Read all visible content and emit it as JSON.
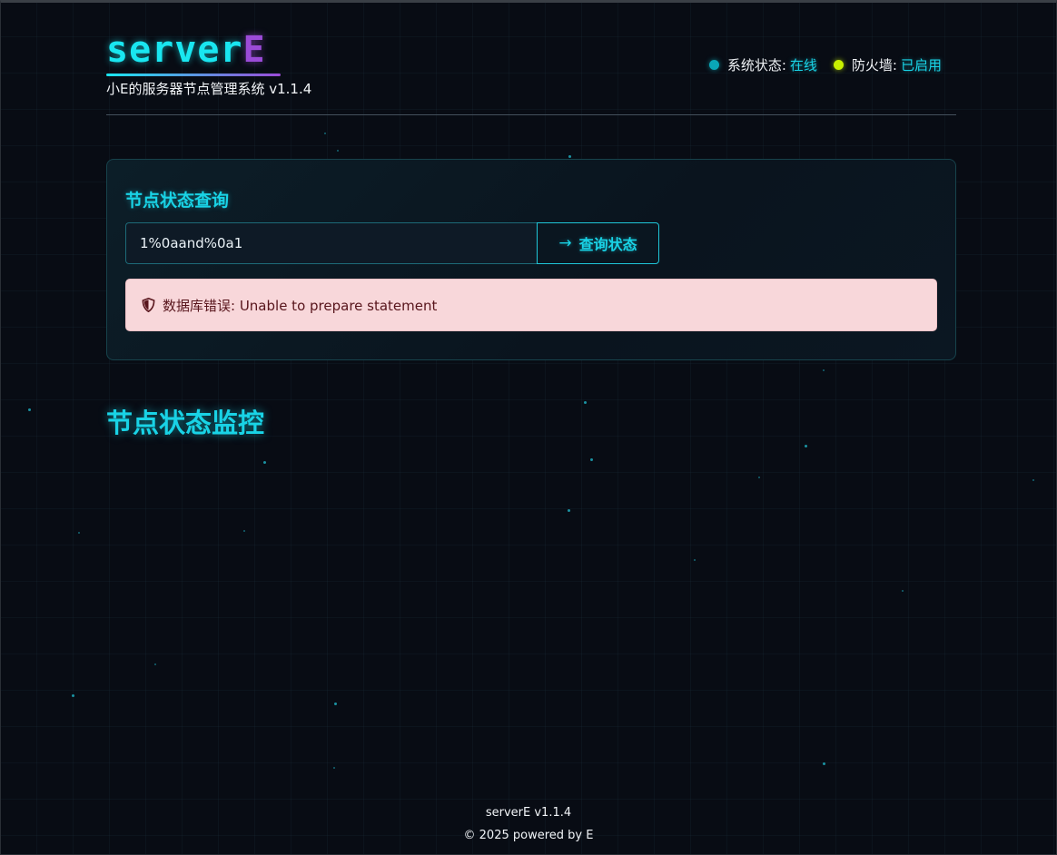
{
  "header": {
    "logo_main": "server",
    "logo_accent": "E",
    "subtitle": "小E的服务器节点管理系统 v1.1.4",
    "system_status_label": "系统状态:",
    "system_status_value": "在线",
    "firewall_label": "防火墙:",
    "firewall_value": "已启用"
  },
  "query": {
    "title": "节点状态查询",
    "input_value": "1%0aand%0a1",
    "button_icon": "→",
    "button_label": "查询状态",
    "error_icon": "shield-halved-icon",
    "error_text": "数据库错误: Unable to prepare statement"
  },
  "monitor": {
    "title": "节点状态监控"
  },
  "footer": {
    "version": "serverE v1.1.4",
    "copyright": "© 2025 powered by E"
  },
  "colors": {
    "accent_cyan": "#19d3e6",
    "accent_purple": "#9b4bd8",
    "status_online": "#0aa6b8",
    "status_firewall": "#c8f000",
    "error_bg": "#f8d7da",
    "error_text": "#58151c"
  }
}
